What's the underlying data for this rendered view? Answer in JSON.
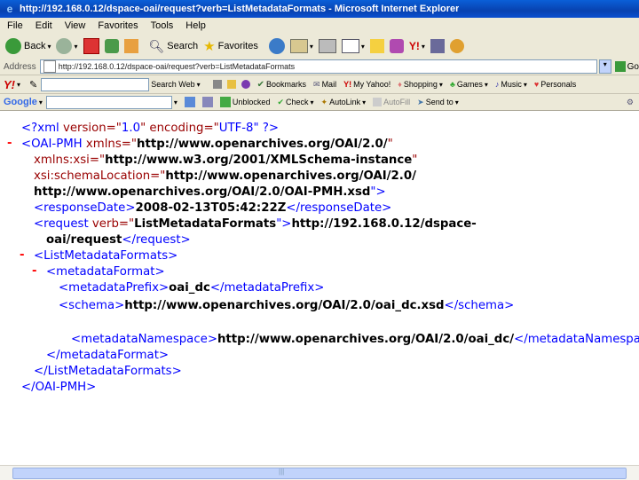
{
  "window": {
    "title": "http://192.168.0.12/dspace-oai/request?verb=ListMetadataFormats - Microsoft Internet Explorer"
  },
  "menu": [
    "File",
    "Edit",
    "View",
    "Favorites",
    "Tools",
    "Help"
  ],
  "toolbar": {
    "back": "Back",
    "search": "Search",
    "favorites": "Favorites"
  },
  "address": {
    "label": "Address",
    "value": "http://192.168.0.12/dspace-oai/request?verb=ListMetadataFormats",
    "go": "Go"
  },
  "yahoo_toolbar": {
    "logo": "Y!",
    "search_web": "Search Web",
    "bookmarks": "Bookmarks",
    "mail": "Mail",
    "my_yahoo": "My Yahoo!",
    "shopping": "Shopping",
    "games": "Games",
    "music": "Music",
    "personals": "Personals"
  },
  "google_toolbar": {
    "logo": "Google",
    "blocked": "Unblocked",
    "check": "Check",
    "autolink": "AutoLink",
    "autofill": "AutoFill",
    "send_to": "Send to"
  },
  "xml": {
    "decl_open": "<?xml ",
    "decl_version_attr": "version=\"",
    "decl_version_val": "1.0",
    "decl_encoding_attr": "\" encoding=\"",
    "decl_encoding_val": "UTF-8",
    "decl_close": "\" ?>",
    "oai_open": "<OAI-PMH ",
    "xmlns_attr": "xmlns=\"",
    "xmlns_val": "http://www.openarchives.org/OAI/2.0/",
    "xmlns_close": "\"",
    "xsi_attr": "xmlns:xsi=\"",
    "xsi_val": "http://www.w3.org/2001/XMLSchema-instance",
    "xsi_close": "\"",
    "schemaloc_attr": "xsi:schemaLocation=\"",
    "schemaloc_val1": "http://www.openarchives.org/OAI/2.0/",
    "schemaloc_val2": "http://www.openarchives.org/OAI/2.0/OAI-PMH.xsd",
    "schemaloc_close": "\">",
    "resp_open": "<responseDate>",
    "resp_val": "2008-02-13T05:42:22Z",
    "resp_close": "</responseDate>",
    "req_open": "<request ",
    "req_attr": "verb=\"",
    "req_attr_val": "ListMetadataFormats",
    "req_attr_close": "\">",
    "req_val1": "http://192.168.0.12/dspace-",
    "req_val2": "oai/request",
    "req_close": "</request>",
    "lmf_open": "<ListMetadataFormats>",
    "mf_open": "<metadataFormat>",
    "mp_open": "<metadataPrefix>",
    "mp_val": "oai_dc",
    "mp_close": "</metadataPrefix>",
    "schema_open": "<schema>",
    "schema_val": "http://www.openarchives.org/OAI/2.0/oai_dc.xsd",
    "schema_close": "</schema>",
    "mn_open": "<metadataNamespace>",
    "mn_val": "http://www.openarchives.org/OAI/2.0/oai_dc/",
    "mn_close": "</metadataNamespace>",
    "mf_close": "</metadataFormat>",
    "lmf_close": "</ListMetadataFormats>",
    "oai_close": "</OAI-PMH>",
    "minus": "-"
  }
}
